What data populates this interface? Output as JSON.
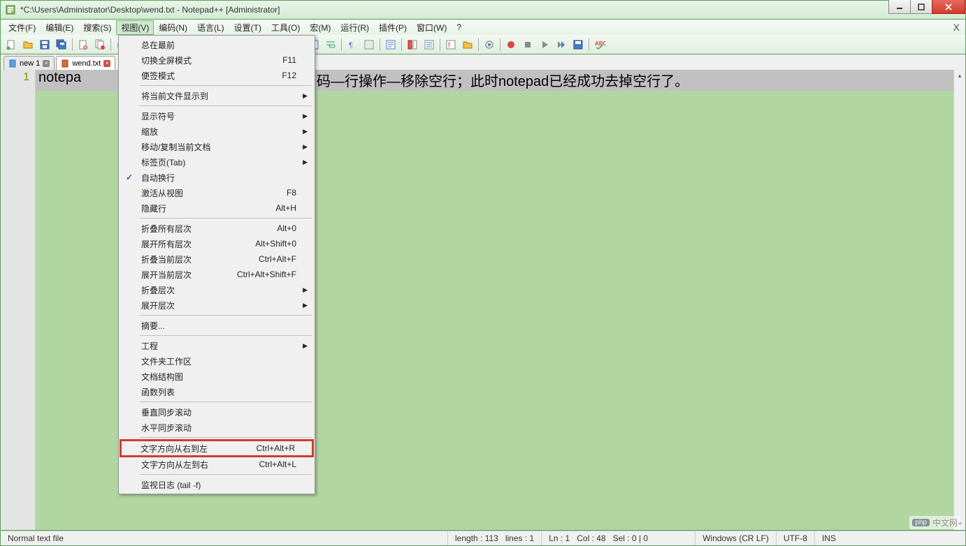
{
  "window": {
    "title": "*C:\\Users\\Administrator\\Desktop\\wend.txt - Notepad++ [Administrator]"
  },
  "menubar": {
    "items": [
      {
        "label": "文件(F)"
      },
      {
        "label": "编辑(E)"
      },
      {
        "label": "搜索(S)"
      },
      {
        "label": "视图(V)",
        "active": true
      },
      {
        "label": "编码(N)"
      },
      {
        "label": "语言(L)"
      },
      {
        "label": "设置(T)"
      },
      {
        "label": "工具(O)"
      },
      {
        "label": "宏(M)"
      },
      {
        "label": "运行(R)"
      },
      {
        "label": "插件(P)"
      },
      {
        "label": "窗口(W)"
      },
      {
        "label": "?"
      }
    ],
    "close_symbol": "X"
  },
  "tabs": [
    {
      "label": "new 1",
      "active": false,
      "icon_color": "#5aa0e0"
    },
    {
      "label": "wend.txt",
      "active": true,
      "icon_color": "#d46a3a"
    }
  ],
  "editor": {
    "line_number": "1",
    "text_visible_left": "notepa",
    "text_visible_right": "码—行操作—移除空行；此时notepad已经成功去掉空行了。"
  },
  "dropdown": {
    "items": [
      {
        "type": "item",
        "label": "总在最前"
      },
      {
        "type": "item",
        "label": "切换全屏模式",
        "shortcut": "F11"
      },
      {
        "type": "item",
        "label": "便签模式",
        "shortcut": "F12"
      },
      {
        "type": "sep"
      },
      {
        "type": "item",
        "label": "将当前文件显示到",
        "submenu": true
      },
      {
        "type": "sep"
      },
      {
        "type": "item",
        "label": "显示符号",
        "submenu": true
      },
      {
        "type": "item",
        "label": "缩放",
        "submenu": true
      },
      {
        "type": "item",
        "label": "移动/复制当前文档",
        "submenu": true
      },
      {
        "type": "item",
        "label": "标签页(Tab)",
        "submenu": true
      },
      {
        "type": "item",
        "label": "自动换行",
        "checked": true
      },
      {
        "type": "item",
        "label": "激活从视图",
        "shortcut": "F8"
      },
      {
        "type": "item",
        "label": "隐藏行",
        "shortcut": "Alt+H"
      },
      {
        "type": "sep"
      },
      {
        "type": "item",
        "label": "折叠所有层次",
        "shortcut": "Alt+0"
      },
      {
        "type": "item",
        "label": "展开所有层次",
        "shortcut": "Alt+Shift+0"
      },
      {
        "type": "item",
        "label": "折叠当前层次",
        "shortcut": "Ctrl+Alt+F"
      },
      {
        "type": "item",
        "label": "展开当前层次",
        "shortcut": "Ctrl+Alt+Shift+F"
      },
      {
        "type": "item",
        "label": "折叠层次",
        "submenu": true
      },
      {
        "type": "item",
        "label": "展开层次",
        "submenu": true
      },
      {
        "type": "sep"
      },
      {
        "type": "item",
        "label": "摘要..."
      },
      {
        "type": "sep"
      },
      {
        "type": "item",
        "label": "工程",
        "submenu": true
      },
      {
        "type": "item",
        "label": "文件夹工作区"
      },
      {
        "type": "item",
        "label": "文档结构图"
      },
      {
        "type": "item",
        "label": "函数列表"
      },
      {
        "type": "sep"
      },
      {
        "type": "item",
        "label": "垂直同步滚动"
      },
      {
        "type": "item",
        "label": "水平同步滚动"
      },
      {
        "type": "sep"
      },
      {
        "type": "item",
        "label": "文字方向从右到左",
        "shortcut": "Ctrl+Alt+R",
        "highlighted": true
      },
      {
        "type": "item",
        "label": "文字方向从左到右",
        "shortcut": "Ctrl+Alt+L"
      },
      {
        "type": "sep"
      },
      {
        "type": "item",
        "label": "监视日志 (tail -f)"
      }
    ]
  },
  "statusbar": {
    "file_type": "Normal text file",
    "length": "length : 113",
    "lines": "lines : 1",
    "ln": "Ln : 1",
    "col": "Col : 48",
    "sel": "Sel : 0 | 0",
    "eol": "Windows (CR LF)",
    "encoding": "UTF-8",
    "mode": "INS"
  },
  "watermark": {
    "badge": "php",
    "text": "中文网"
  }
}
